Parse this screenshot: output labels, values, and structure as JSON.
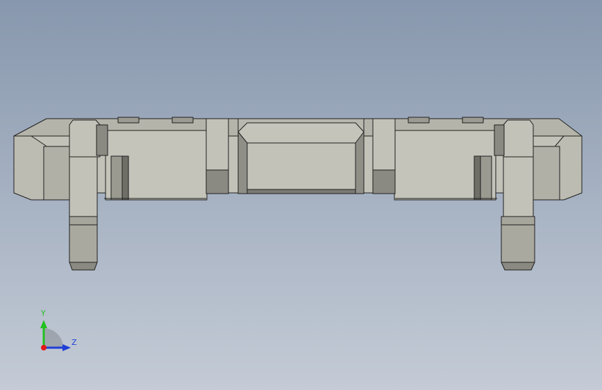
{
  "triad": {
    "y_label": "Y",
    "z_label": "Z",
    "colors": {
      "y": "#22c020",
      "z": "#1f3fd6",
      "x": "#e01818"
    }
  },
  "model": {
    "colors": {
      "face_light": "#c2c2b8",
      "face_mid": "#b4b4aa",
      "face_dark": "#8a8a82",
      "face_shadow": "#6f6f68",
      "edge": "#1e1e1e"
    }
  }
}
